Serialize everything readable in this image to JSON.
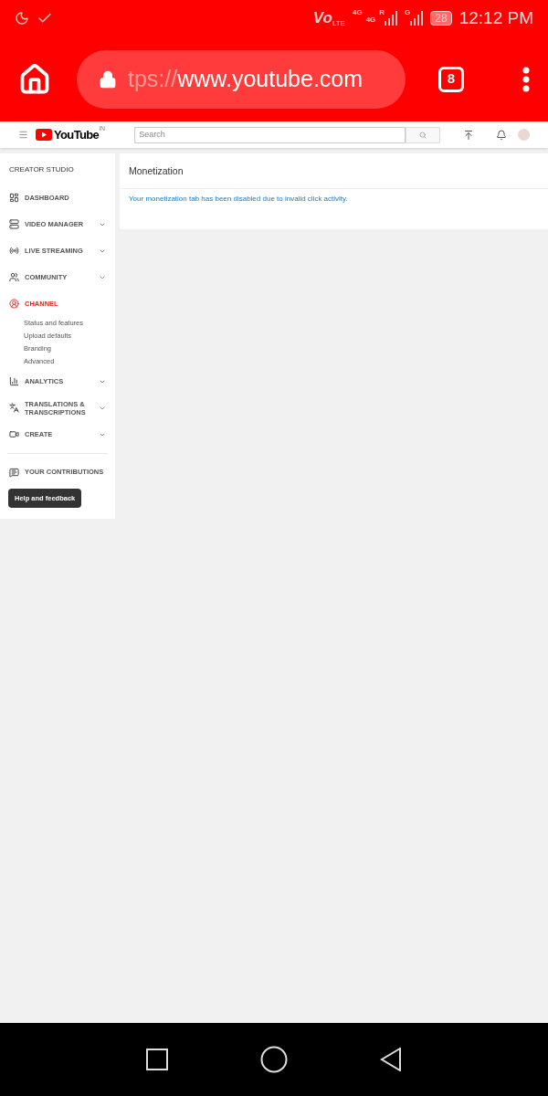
{
  "status_bar": {
    "volte": "Vo",
    "volte_sub": "LTE",
    "network_1": "4G",
    "network_2": "4G",
    "roaming": "R",
    "network_3": "G",
    "battery": "28",
    "time": "12:12 PM"
  },
  "browser": {
    "url_faded": "tps://",
    "url": "www.youtube.com",
    "tab_count": "8"
  },
  "header": {
    "logo": "YouTube",
    "region": "IN",
    "search": {
      "placeholder": "Search"
    }
  },
  "sidebar": {
    "title": "CREATOR STUDIO",
    "items": [
      {
        "kind": "dashboard",
        "label": "DASHBOARD",
        "expandable": false,
        "selected": false
      },
      {
        "kind": "video",
        "label": "VIDEO MANAGER",
        "expandable": true,
        "selected": false
      },
      {
        "kind": "live",
        "label": "LIVE STREAMING",
        "expandable": true,
        "selected": false
      },
      {
        "kind": "community",
        "label": "COMMUNITY",
        "expandable": true,
        "selected": false
      },
      {
        "kind": "channel",
        "label": "CHANNEL",
        "expandable": false,
        "selected": true,
        "children": [
          "Status and features",
          "Upload defaults",
          "Branding",
          "Advanced"
        ]
      },
      {
        "kind": "analytics",
        "label": "ANALYTICS",
        "expandable": true,
        "selected": false
      },
      {
        "kind": "translations",
        "label": "TRANSLATIONS & TRANSCRIPTIONS",
        "expandable": true,
        "selected": false
      },
      {
        "kind": "create",
        "label": "CREATE",
        "expandable": true,
        "selected": false
      }
    ],
    "contributions": "YOUR CONTRIBUTIONS",
    "help_button": "Help and feedback"
  },
  "main": {
    "title": "Monetization",
    "message": "Your monetization tab has been disabled due to invalid click activity."
  }
}
